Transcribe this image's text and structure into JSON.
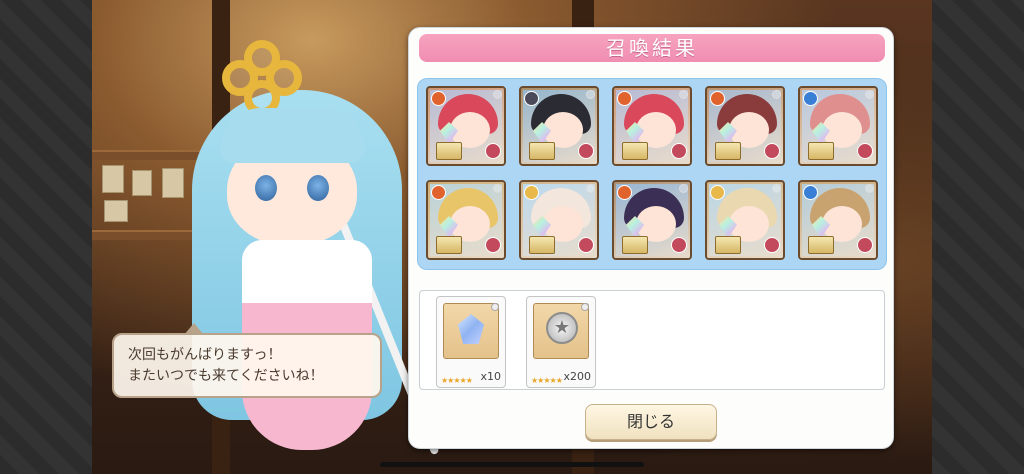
{
  "dialog": {
    "title": "召喚結果",
    "close_label": "閉じる"
  },
  "speech": {
    "line1": "次回もがんばりますっ！",
    "line2": "またいつでも来てくださいね！"
  },
  "results": [
    {
      "element": "fire",
      "element_color": "#e0632e",
      "hair_color": "#d9485b",
      "role_color": "#c24a5c"
    },
    {
      "element": "dark",
      "element_color": "#4a4a5a",
      "hair_color": "#2b2b33",
      "role_color": "#c24a5c"
    },
    {
      "element": "fire",
      "element_color": "#e0632e",
      "hair_color": "#d9485b",
      "role_color": "#c24a5c"
    },
    {
      "element": "fire",
      "element_color": "#e0632e",
      "hair_color": "#8a3b3b",
      "role_color": "#c24a5c"
    },
    {
      "element": "water",
      "element_color": "#3a7fd6",
      "hair_color": "#e08f8f",
      "role_color": "#c24a5c"
    },
    {
      "element": "fire",
      "element_color": "#e0632e",
      "hair_color": "#e9c56a",
      "role_color": "#c24a5c"
    },
    {
      "element": "light",
      "element_color": "#e8b84a",
      "hair_color": "#f3e6dc",
      "role_color": "#c24a5c"
    },
    {
      "element": "fire",
      "element_color": "#e0632e",
      "hair_color": "#3b2f55",
      "role_color": "#c24a5c"
    },
    {
      "element": "light",
      "element_color": "#e8b84a",
      "hair_color": "#ead8b0",
      "role_color": "#c24a5c"
    },
    {
      "element": "water",
      "element_color": "#3a7fd6",
      "hair_color": "#c9a36f",
      "role_color": "#c24a5c"
    }
  ],
  "items": [
    {
      "kind": "crystal",
      "quantity": "x10",
      "stars": "★★★★★"
    },
    {
      "kind": "silver-medal",
      "quantity": "x200",
      "stars": "★★★★★"
    }
  ]
}
